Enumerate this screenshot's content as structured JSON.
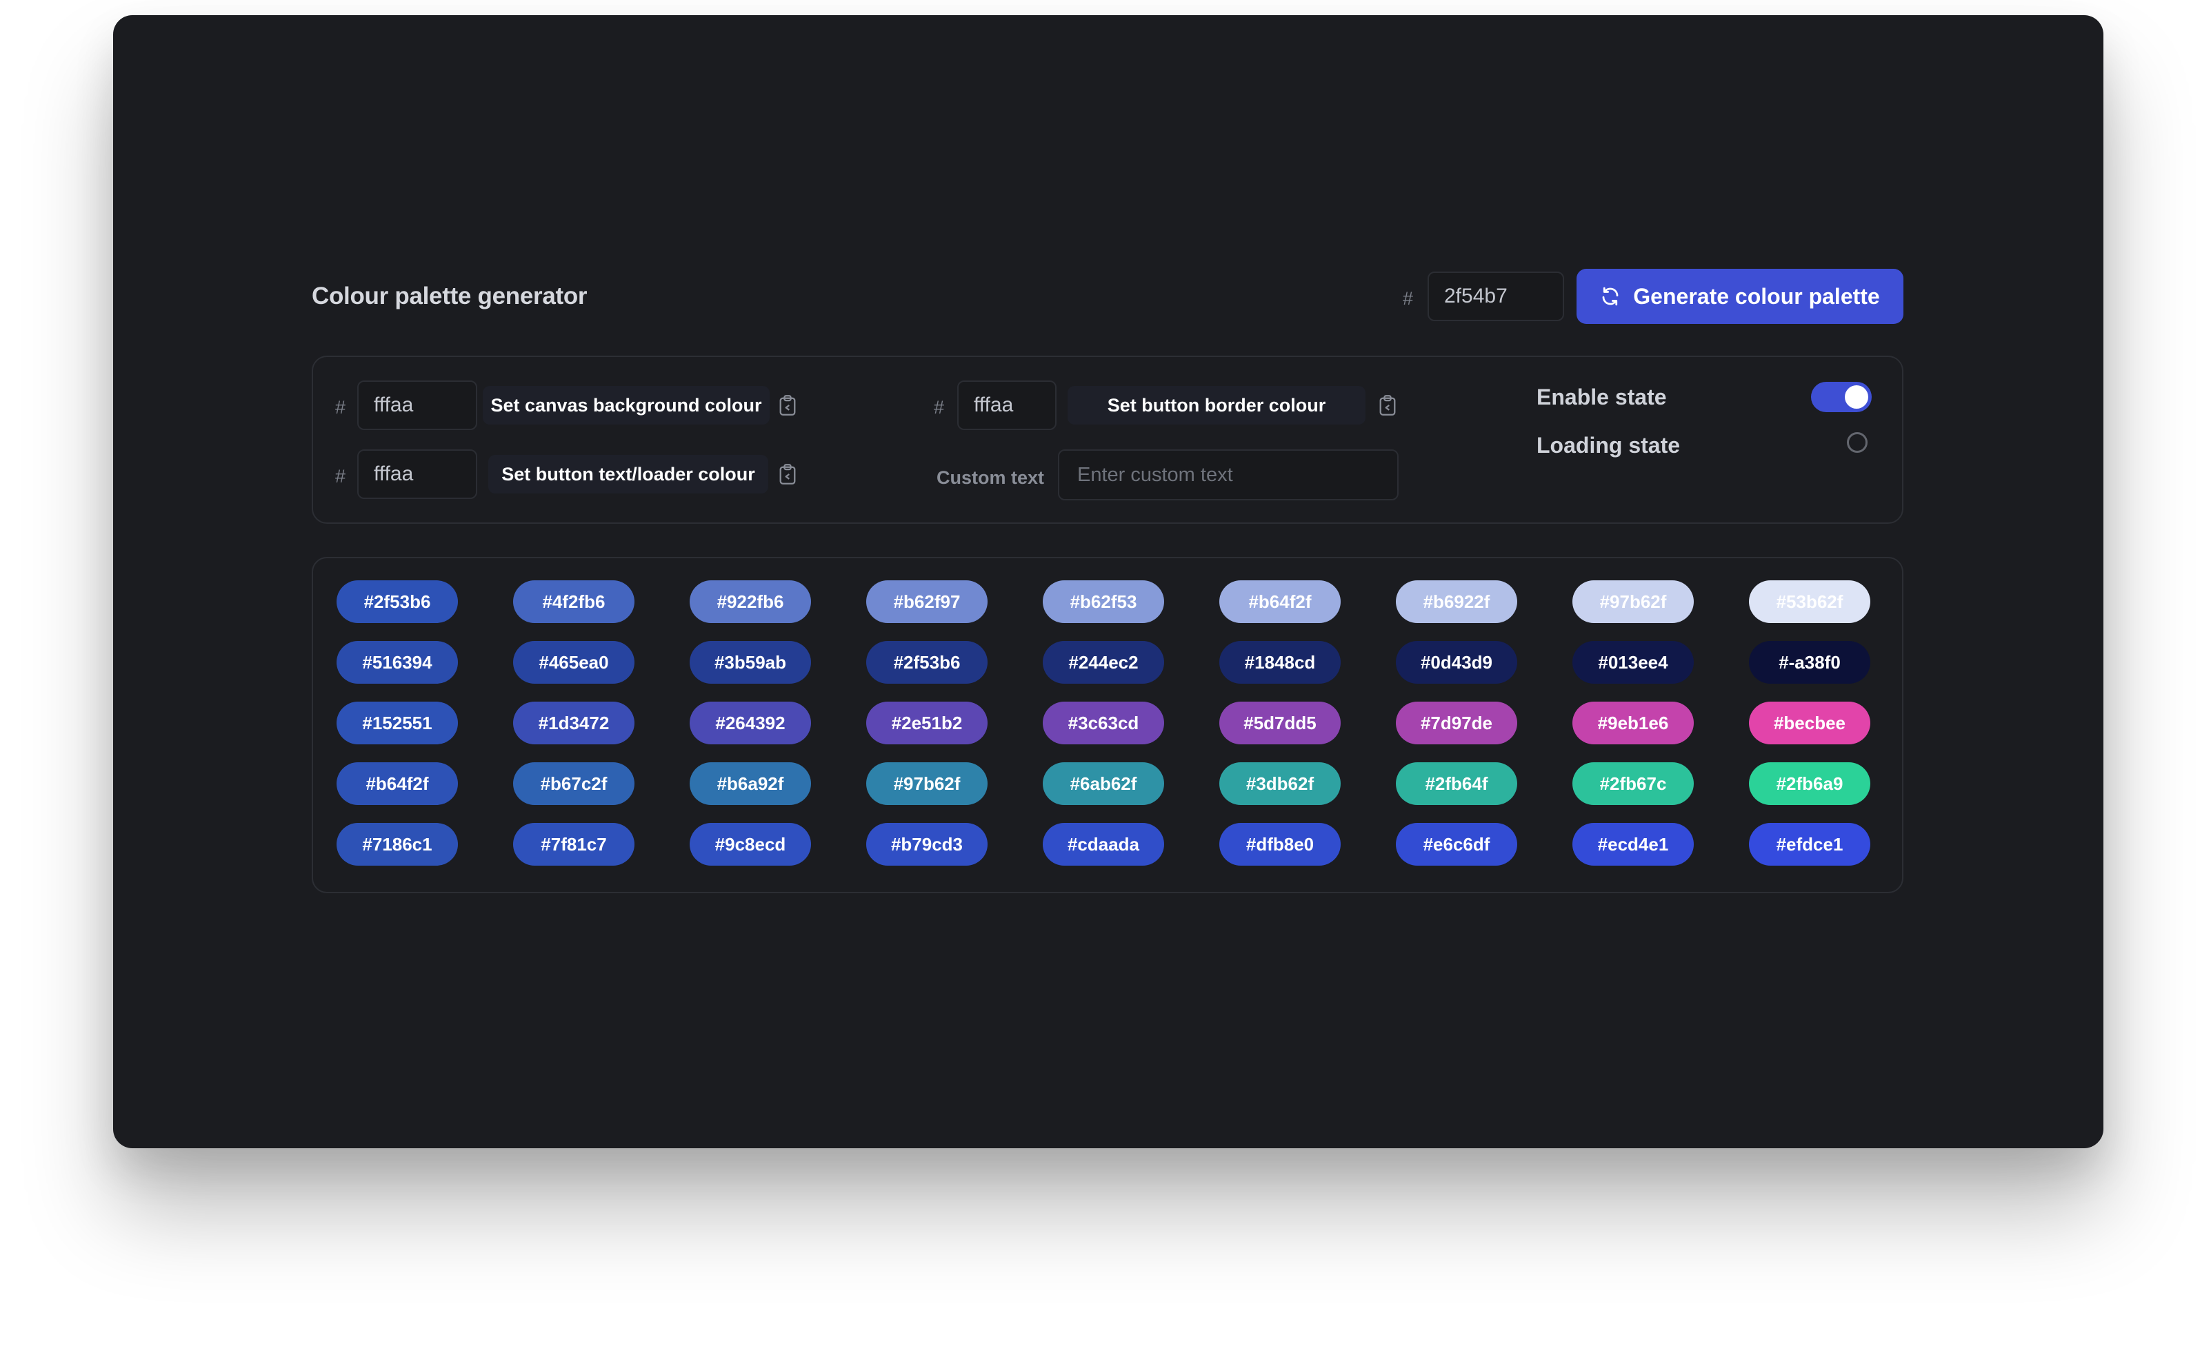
{
  "header": {
    "title": "Colour palette generator",
    "hash_symbol": "#",
    "hex_value": "2f54b7",
    "generate_label": "Generate colour palette"
  },
  "controls": {
    "hash_symbol": "#",
    "canvas_bg": {
      "value": "fffaa",
      "button_label": "Set canvas background colour"
    },
    "button_text": {
      "value": "fffaa",
      "button_label": "Set button text/loader colour"
    },
    "button_border": {
      "value": "fffaa",
      "button_label": "Set button border colour"
    },
    "custom_text": {
      "label": "Custom text",
      "placeholder": "Enter custom text",
      "value": ""
    },
    "enable_state": {
      "label": "Enable state",
      "on": true
    },
    "loading_state": {
      "label": "Loading state",
      "on": false
    }
  },
  "accent_color": "#3e4fd4",
  "palette": [
    [
      {
        "label": "#2f53b6",
        "bg": "#2d52b6",
        "fg": "#ffffff"
      },
      {
        "label": "#4f2fb6",
        "bg": "#4465bf",
        "fg": "#ffffff"
      },
      {
        "label": "#922fb6",
        "bg": "#5b77c8",
        "fg": "#ffffff"
      },
      {
        "label": "#b62f97",
        "bg": "#7189d1",
        "fg": "#ffffff"
      },
      {
        "label": "#b62f53",
        "bg": "#869bd9",
        "fg": "#ffffff"
      },
      {
        "label": "#b64f2f",
        "bg": "#9cade1",
        "fg": "#ffffff"
      },
      {
        "label": "#b6922f",
        "bg": "#b2c0e8",
        "fg": "#ffffff"
      },
      {
        "label": "#97b62f",
        "bg": "#c8d2ef",
        "fg": "#ffffff"
      },
      {
        "label": "#53b62f",
        "bg": "#dde4f6",
        "fg": "#ffffff"
      }
    ],
    [
      {
        "label": "#516394",
        "bg": "#2a4cac",
        "fg": "#ffffff"
      },
      {
        "label": "#465ea0",
        "bg": "#2744a0",
        "fg": "#ffffff"
      },
      {
        "label": "#3b59ab",
        "bg": "#243d93",
        "fg": "#ffffff"
      },
      {
        "label": "#2f53b6",
        "bg": "#203685",
        "fg": "#ffffff"
      },
      {
        "label": "#244ec2",
        "bg": "#1c2e76",
        "fg": "#ffffff"
      },
      {
        "label": "#1848cd",
        "bg": "#182767",
        "fg": "#ffffff"
      },
      {
        "label": "#0d43d9",
        "bg": "#141f58",
        "fg": "#ffffff"
      },
      {
        "label": "#013ee4",
        "bg": "#101849",
        "fg": "#ffffff"
      },
      {
        "label": "#-a38f0",
        "bg": "#0c1138",
        "fg": "#ffffff"
      }
    ],
    [
      {
        "label": "#152551",
        "bg": "#2d52b6",
        "fg": "#ffffff"
      },
      {
        "label": "#1d3472",
        "bg": "#3a4db5",
        "fg": "#ffffff"
      },
      {
        "label": "#264392",
        "bg": "#4b4ab4",
        "fg": "#ffffff"
      },
      {
        "label": "#2e51b2",
        "bg": "#5c47b3",
        "fg": "#ffffff"
      },
      {
        "label": "#3c63cd",
        "bg": "#7045b2",
        "fg": "#ffffff"
      },
      {
        "label": "#5d7dd5",
        "bg": "#8844b0",
        "fg": "#ffffff"
      },
      {
        "label": "#7d97de",
        "bg": "#a544ae",
        "fg": "#ffffff"
      },
      {
        "label": "#9eb1e6",
        "bg": "#c443ac",
        "fg": "#ffffff"
      },
      {
        "label": "#becbee",
        "bg": "#e244aa",
        "fg": "#ffffff"
      }
    ],
    [
      {
        "label": "#b64f2f",
        "bg": "#2d52b6",
        "fg": "#ffffff"
      },
      {
        "label": "#b67c2f",
        "bg": "#2e62b2",
        "fg": "#ffffff"
      },
      {
        "label": "#b6a92f",
        "bg": "#2e72ae",
        "fg": "#ffffff"
      },
      {
        "label": "#97b62f",
        "bg": "#2e82aa",
        "fg": "#ffffff"
      },
      {
        "label": "#6ab62f",
        "bg": "#2e92a6",
        "fg": "#ffffff"
      },
      {
        "label": "#3db62f",
        "bg": "#2ea2a2",
        "fg": "#ffffff"
      },
      {
        "label": "#2fb64f",
        "bg": "#2db29e",
        "fg": "#ffffff"
      },
      {
        "label": "#2fb67c",
        "bg": "#2cc29b",
        "fg": "#ffffff"
      },
      {
        "label": "#2fb6a9",
        "bg": "#2bd298",
        "fg": "#ffffff"
      }
    ],
    [
      {
        "label": "#7186c1",
        "bg": "#2d52b6",
        "fg": "#ffffff"
      },
      {
        "label": "#7f81c7",
        "bg": "#2e51bb",
        "fg": "#ffffff"
      },
      {
        "label": "#9c8ecd",
        "bg": "#2f50c0",
        "fg": "#ffffff"
      },
      {
        "label": "#b79cd3",
        "bg": "#304fc5",
        "fg": "#ffffff"
      },
      {
        "label": "#cdaada",
        "bg": "#304ec9",
        "fg": "#ffffff"
      },
      {
        "label": "#dfb8e0",
        "bg": "#314dce",
        "fg": "#ffffff"
      },
      {
        "label": "#e6c6df",
        "bg": "#324cd3",
        "fg": "#ffffff"
      },
      {
        "label": "#ecd4e1",
        "bg": "#334bd8",
        "fg": "#ffffff"
      },
      {
        "label": "#efdce1",
        "bg": "#344bde",
        "fg": "#ffffff"
      }
    ]
  ]
}
